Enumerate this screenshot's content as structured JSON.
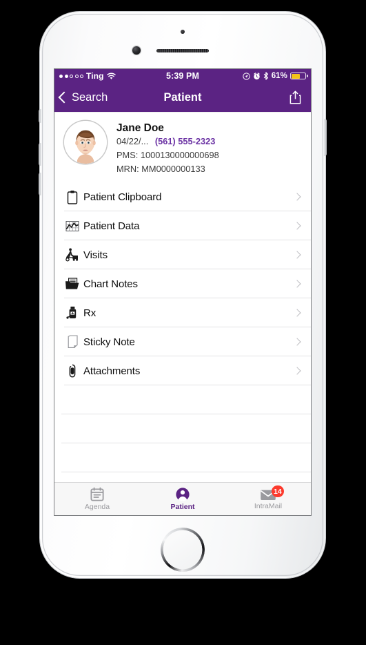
{
  "status_bar": {
    "carrier": "Ting",
    "signal_filled_dots": 2,
    "signal_total_dots": 5,
    "wifi_icon": "wifi-icon",
    "time": "5:39 PM",
    "location_icon": "location-arrow-icon",
    "alarm_icon": "alarm-clock-icon",
    "bluetooth_icon": "bluetooth-icon",
    "battery_percent": "61%",
    "battery_fill_color": "#f5c518",
    "bar_color": "#5b2383"
  },
  "nav_bar": {
    "back_label": "Search",
    "back_icon": "chevron-left-icon",
    "title": "Patient",
    "share_icon": "share-icon"
  },
  "patient": {
    "avatar_icon": "patient-avatar",
    "name": "Jane Doe",
    "dob": "04/22/...",
    "phone": "(561) 555-2323",
    "pms": "PMS: 1000130000000698",
    "mrn": "MRN: MM0000000133",
    "phone_color": "#6a31a3"
  },
  "menu": {
    "items": [
      {
        "label": "Patient Clipboard",
        "icon": "clipboard-icon"
      },
      {
        "label": "Patient Data",
        "icon": "chart-grid-icon"
      },
      {
        "label": "Visits",
        "icon": "visits-icon"
      },
      {
        "label": "Chart Notes",
        "icon": "folder-notes-icon"
      },
      {
        "label": "Rx",
        "icon": "pill-bottle-icon"
      },
      {
        "label": "Sticky Note",
        "icon": "sticky-note-icon"
      },
      {
        "label": "Attachments",
        "icon": "paperclip-icon"
      }
    ],
    "disclosure_icon": "chevron-right-icon"
  },
  "tab_bar": {
    "tabs": [
      {
        "label": "Agenda",
        "icon": "calendar-icon",
        "active": false,
        "badge": ""
      },
      {
        "label": "Patient",
        "icon": "person-icon",
        "active": true,
        "badge": ""
      },
      {
        "label": "IntraMail",
        "icon": "envelope-icon",
        "active": false,
        "badge": "14"
      }
    ],
    "active_color": "#5b2383",
    "inactive_color": "#9a9a9e",
    "badge_color": "#fc3a2d"
  },
  "device": {
    "body_color": "#ffffff",
    "home_button_icon": "home-button"
  }
}
